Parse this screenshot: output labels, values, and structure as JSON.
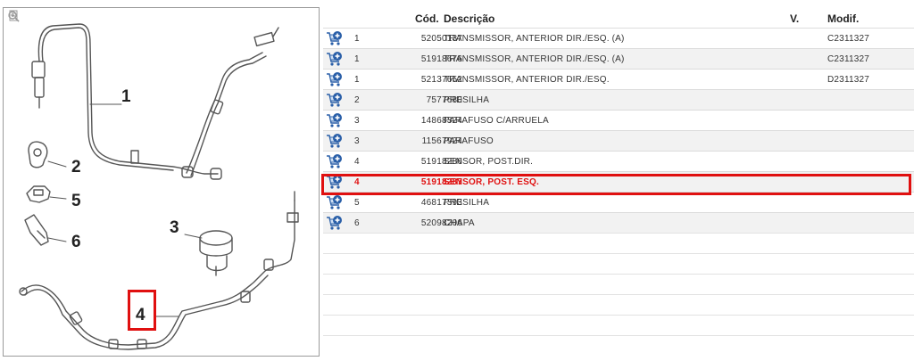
{
  "diagram": {
    "labels": [
      "1",
      "2",
      "5",
      "6",
      "3",
      "4"
    ],
    "highlighted_label": "4",
    "tools": [
      "page-icon",
      "zoom-in-icon",
      "zoom-out-icon"
    ]
  },
  "table": {
    "headers": {
      "cod": "Cód.",
      "descricao": "Descrição",
      "v": "V.",
      "modif": "Modif."
    },
    "rows": [
      {
        "qty": "1",
        "code": "52050137",
        "desc": "TRANSMISSOR, ANTERIOR DIR./ESQ. (A)",
        "modif": "C2311327"
      },
      {
        "qty": "1",
        "code": "51918676",
        "desc": "TRANSMISSOR, ANTERIOR DIR./ESQ. (A)",
        "modif": "C2311327"
      },
      {
        "qty": "1",
        "code": "52137652",
        "desc": "TRANSMISSOR, ANTERIOR DIR./ESQ.",
        "modif": "D2311327"
      },
      {
        "qty": "2",
        "code": "7577680",
        "desc": "PRESILHA",
        "modif": ""
      },
      {
        "qty": "3",
        "code": "14868324",
        "desc": "PARAFUSO C/ARRUELA",
        "modif": ""
      },
      {
        "qty": "3",
        "code": "11567924",
        "desc": "PARAFUSO",
        "modif": ""
      },
      {
        "qty": "4",
        "code": "51918286",
        "desc": "SENSOR, POST.DIR.",
        "modif": ""
      },
      {
        "qty": "4",
        "code": "51918287",
        "desc": "SENSOR, POST. ESQ.",
        "modif": ""
      },
      {
        "qty": "5",
        "code": "46817393",
        "desc": "PRESILHA",
        "modif": ""
      },
      {
        "qty": "6",
        "code": "52098206",
        "desc": "CHAPA",
        "modif": ""
      }
    ],
    "selected_index": 7
  },
  "colors": {
    "highlight": "#e01010",
    "cart": "#2a5fa8"
  }
}
